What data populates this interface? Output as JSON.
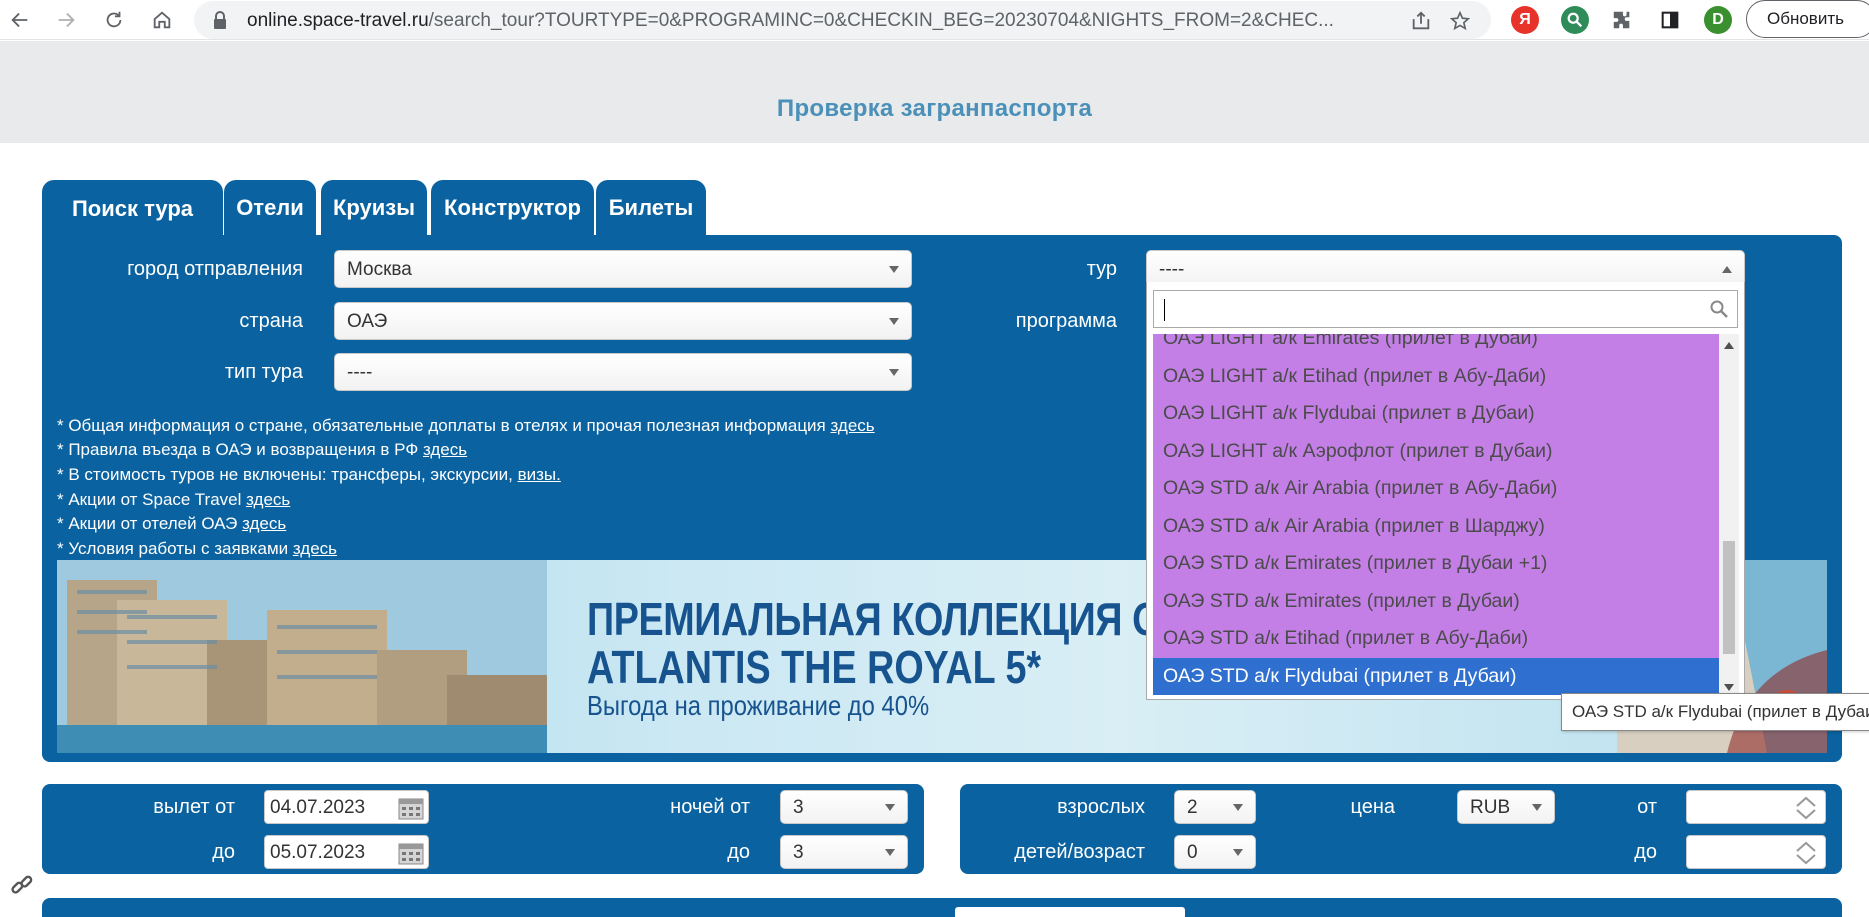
{
  "browser": {
    "url_host": "online.space-travel.ru",
    "url_path": "/search_tour?TOURTYPE=0&PROGRAMINC=0&CHECKIN_BEG=20230704&NIGHTS_FROM=2&CHEC...",
    "profile_letter": "D",
    "update_label": "Обновить",
    "yandex_letter": "Я"
  },
  "header": {
    "passport_link": "Проверка загранпаспорта"
  },
  "tabs": [
    "Поиск тура",
    "Отели",
    "Круизы",
    "Конструктор",
    "Билеты"
  ],
  "search": {
    "city_label": "город отправления",
    "city_value": "Москва",
    "country_label": "страна",
    "country_value": "ОАЭ",
    "tourtype_label": "тип тура",
    "tourtype_value": "----",
    "tour_label": "тур",
    "tour_value": "----",
    "program_label": "программа"
  },
  "info_lines": [
    {
      "text": "* Общая информация о стране, обязательные доплаты в отелях и прочая полезная информация ",
      "link": "здесь"
    },
    {
      "text": "* Правила въезда в ОАЭ и возвращения в РФ ",
      "link": "здесь"
    },
    {
      "text": "* В стоимость туров не включены: трансферы, экскурсии, ",
      "link": "визы."
    },
    {
      "text": "* Акции от Space Travel ",
      "link": "здесь"
    },
    {
      "text": "* Акции от отелей ОАЭ ",
      "link": "здесь"
    },
    {
      "text": "* Условия работы с заявками ",
      "link": "здесь"
    }
  ],
  "banner": {
    "line1": "ПРЕМИАЛЬНАЯ КОЛЛЕКЦИЯ ОТ",
    "line2": "ATLANTIS THE ROYAL 5*",
    "line3": "Выгода на проживание до 40%"
  },
  "tour_dropdown": {
    "search_value": "",
    "items": [
      "ОАЭ LIGHT а/к Emirates (прилет в Дубаи)",
      "ОАЭ LIGHT а/к Etihad (прилет в Абу-Даби)",
      "ОАЭ LIGHT а/к Flydubai (прилет в Дубаи)",
      "ОАЭ LIGHT а/к Аэрофлот (прилет в Дубаи)",
      "ОАЭ STD а/к Air Arabia (прилет в Абу-Даби)",
      "ОАЭ STD а/к Air Arabia (прилет в Шарджу)",
      "ОАЭ STD а/к Emirates (прилет в Дубаи +1)",
      "ОАЭ STD а/к Emirates (прилет в Дубаи)",
      "ОАЭ STD а/к Etihad (прилет в Абу-Даби)",
      "ОАЭ STD а/к Flydubai (прилет в Дубаи)"
    ],
    "highlighted_index": 9,
    "tooltip": "ОАЭ STD а/к Flydubai (прилет в Дубаи)"
  },
  "dates": {
    "depart_from_label": "вылет от",
    "depart_from_value": "04.07.2023",
    "depart_to_label": "до",
    "depart_to_value": "05.07.2023",
    "nights_from_label": "ночей от",
    "nights_from_value": "3",
    "nights_to_label": "до",
    "nights_to_value": "3"
  },
  "people": {
    "adults_label": "взрослых",
    "adults_value": "2",
    "children_label": "детей/возраст",
    "children_value": "0",
    "price_label": "цена",
    "currency_value": "RUB",
    "price_from_label": "от",
    "price_from_value": "",
    "price_to_label": "до",
    "price_to_value": ""
  },
  "colors": {
    "panel_blue": "#0a62a0",
    "dropdown_item": "#c47fe7",
    "dropdown_highlight": "#2f6fcf",
    "passport_link": "#4a90b8"
  }
}
